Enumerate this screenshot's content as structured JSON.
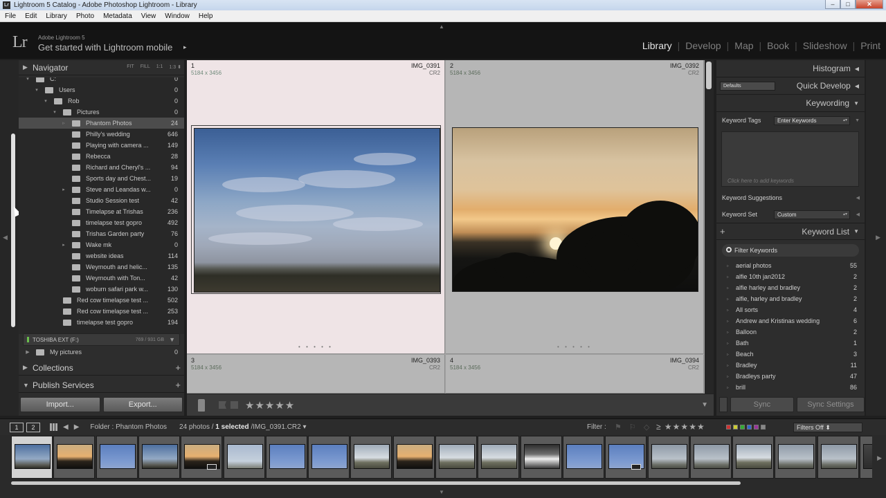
{
  "window": {
    "title": "Lightroom 5 Catalog - Adobe Photoshop Lightroom - Library",
    "app_icon": "Lr",
    "min": "–",
    "max": "□",
    "close": "✕"
  },
  "menu": [
    "File",
    "Edit",
    "Library",
    "Photo",
    "Metadata",
    "View",
    "Window",
    "Help"
  ],
  "identity": {
    "logo": "Lr",
    "small": "Adobe Lightroom 5",
    "big": "Get started with Lightroom mobile",
    "arrow": "▸"
  },
  "modules": [
    "Library",
    "Develop",
    "Map",
    "Book",
    "Slideshow",
    "Print"
  ],
  "active_module": "Library",
  "navigator": {
    "title": "Navigator",
    "options": [
      "FIT",
      "FILL",
      "1:1",
      "1:3 ⬍"
    ]
  },
  "folders": [
    {
      "name": "C:",
      "count": "0",
      "indent": 0,
      "tri": "▾",
      "sel": false
    },
    {
      "name": "Users",
      "count": "0",
      "indent": 1,
      "tri": "▾",
      "sel": false
    },
    {
      "name": "Rob",
      "count": "0",
      "indent": 2,
      "tri": "▾",
      "sel": false
    },
    {
      "name": "Pictures",
      "count": "0",
      "indent": 3,
      "tri": "▾",
      "sel": false
    },
    {
      "name": "Phantom Photos",
      "count": "24",
      "indent": 4,
      "tri": "▹",
      "sel": true
    },
    {
      "name": "Philly's wedding",
      "count": "646",
      "indent": 4,
      "tri": "",
      "sel": false
    },
    {
      "name": "Playing with camera ...",
      "count": "149",
      "indent": 4,
      "tri": "",
      "sel": false
    },
    {
      "name": "Rebecca",
      "count": "28",
      "indent": 4,
      "tri": "",
      "sel": false
    },
    {
      "name": "Richard and Cheryl's ...",
      "count": "94",
      "indent": 4,
      "tri": "",
      "sel": false
    },
    {
      "name": "Sports day and Chest...",
      "count": "19",
      "indent": 4,
      "tri": "",
      "sel": false
    },
    {
      "name": "Steve and Leandas w...",
      "count": "0",
      "indent": 4,
      "tri": "▸",
      "sel": false
    },
    {
      "name": "Studio Session test",
      "count": "42",
      "indent": 4,
      "tri": "",
      "sel": false
    },
    {
      "name": "Timelapse at Trishas",
      "count": "236",
      "indent": 4,
      "tri": "",
      "sel": false
    },
    {
      "name": "timelapse test gopro",
      "count": "492",
      "indent": 4,
      "tri": "",
      "sel": false
    },
    {
      "name": "Trishas Garden party",
      "count": "76",
      "indent": 4,
      "tri": "",
      "sel": false
    },
    {
      "name": "Wake mk",
      "count": "0",
      "indent": 4,
      "tri": "▸",
      "sel": false
    },
    {
      "name": "website ideas",
      "count": "114",
      "indent": 4,
      "tri": "",
      "sel": false
    },
    {
      "name": "Weymouth and helic...",
      "count": "135",
      "indent": 4,
      "tri": "",
      "sel": false
    },
    {
      "name": "Weymouth with Ton...",
      "count": "42",
      "indent": 4,
      "tri": "",
      "sel": false
    },
    {
      "name": "woburn safari park w...",
      "count": "130",
      "indent": 4,
      "tri": "",
      "sel": false
    },
    {
      "name": "Red cow timelapse test ...",
      "count": "502",
      "indent": 3,
      "tri": "",
      "sel": false
    },
    {
      "name": "Red cow timelapse test ...",
      "count": "253",
      "indent": 3,
      "tri": "",
      "sel": false
    },
    {
      "name": "timelapse test gopro",
      "count": "194",
      "indent": 3,
      "tri": "",
      "sel": false
    }
  ],
  "volume": {
    "name": "TOSHIBA EXT (F:)",
    "capacity": "769 / 931 GB",
    "dd": "▼"
  },
  "my_pictures": {
    "name": "My pictures",
    "count": "0"
  },
  "collections": {
    "title": "Collections",
    "plus": "+"
  },
  "publish": {
    "title": "Publish Services",
    "plus": "+"
  },
  "import_label": "Import...",
  "export_label": "Export...",
  "grid": [
    {
      "index": "1",
      "filename": "IMG_0391",
      "dims": "5184 x 3456",
      "ext": "CR2",
      "selected": true
    },
    {
      "index": "2",
      "filename": "IMG_0392",
      "dims": "5184 x 3456",
      "ext": "CR2",
      "selected": false
    },
    {
      "index": "3",
      "filename": "IMG_0393",
      "dims": "5184 x 3456",
      "ext": "CR2",
      "selected": false
    },
    {
      "index": "4",
      "filename": "IMG_0394",
      "dims": "5184 x 3456",
      "ext": "CR2",
      "selected": false
    }
  ],
  "cell_dots": "• • • • •",
  "toolbar": {
    "stars": "★★★★★",
    "dd": "▼"
  },
  "right": {
    "histogram": "Histogram",
    "quick_develop": "Quick Develop",
    "defaults": "Defaults",
    "keywording": "Keywording",
    "keyword_tags_label": "Keyword Tags",
    "keyword_tags_value": "Enter Keywords",
    "add_hint": "Click here to add keywords",
    "suggestions": "Keyword Suggestions",
    "keyword_set_label": "Keyword Set",
    "keyword_set_value": "Custom",
    "keyword_list": "Keyword List",
    "keyword_list_plus": "+",
    "filter_placeholder": "Filter Keywords",
    "keywords": [
      {
        "name": "aerial photos",
        "count": "55"
      },
      {
        "name": "alfie 10th jan2012",
        "count": "2"
      },
      {
        "name": "alfie harley and bradley",
        "count": "2"
      },
      {
        "name": "alfie, harley and bradley",
        "count": "2"
      },
      {
        "name": "All sorts",
        "count": "4"
      },
      {
        "name": "Andrew and Kristinas wedding",
        "count": "6"
      },
      {
        "name": "Balloon",
        "count": "2"
      },
      {
        "name": "Bath",
        "count": "1"
      },
      {
        "name": "Beach",
        "count": "3"
      },
      {
        "name": "Bradley",
        "count": "11"
      },
      {
        "name": "Bradleys party",
        "count": "47"
      },
      {
        "name": "brill",
        "count": "86"
      }
    ],
    "sync": "Sync",
    "sync_settings": "Sync Settings"
  },
  "filmstrip": {
    "view1": "1",
    "view2": "2",
    "folder": "Folder : Phantom Photos",
    "count_prefix": "24 photos /",
    "selected": "1 selected",
    "path": "/IMG_0391.CR2 ▾",
    "filter_label": "Filter :",
    "filter_stars": "≥ ★★★★★",
    "filter_value": "Filters Off ⬍",
    "thumbs": [
      {
        "kind": "sky",
        "badge": false
      },
      {
        "kind": "sunset",
        "badge": false
      },
      {
        "kind": "blue",
        "badge": false
      },
      {
        "kind": "sky",
        "badge": false
      },
      {
        "kind": "sunset",
        "badge": true
      },
      {
        "kind": "pale",
        "badge": false
      },
      {
        "kind": "blue",
        "badge": false
      },
      {
        "kind": "blue",
        "badge": false
      },
      {
        "kind": "field",
        "badge": false
      },
      {
        "kind": "sunset",
        "badge": false
      },
      {
        "kind": "field",
        "badge": false
      },
      {
        "kind": "field",
        "badge": false
      },
      {
        "kind": "drone",
        "badge": false
      },
      {
        "kind": "blue",
        "badge": false
      },
      {
        "kind": "blue",
        "badge": true
      },
      {
        "kind": "grey",
        "badge": false
      },
      {
        "kind": "grey",
        "badge": false
      },
      {
        "kind": "field",
        "badge": false
      },
      {
        "kind": "grey",
        "badge": false
      },
      {
        "kind": "grey",
        "badge": false
      },
      {
        "kind": "dark",
        "badge": false
      }
    ]
  },
  "colors": {
    "accent": "#e6e6e6",
    "panel": "#2d2d2d",
    "selected_cell": "#efe4e6"
  }
}
